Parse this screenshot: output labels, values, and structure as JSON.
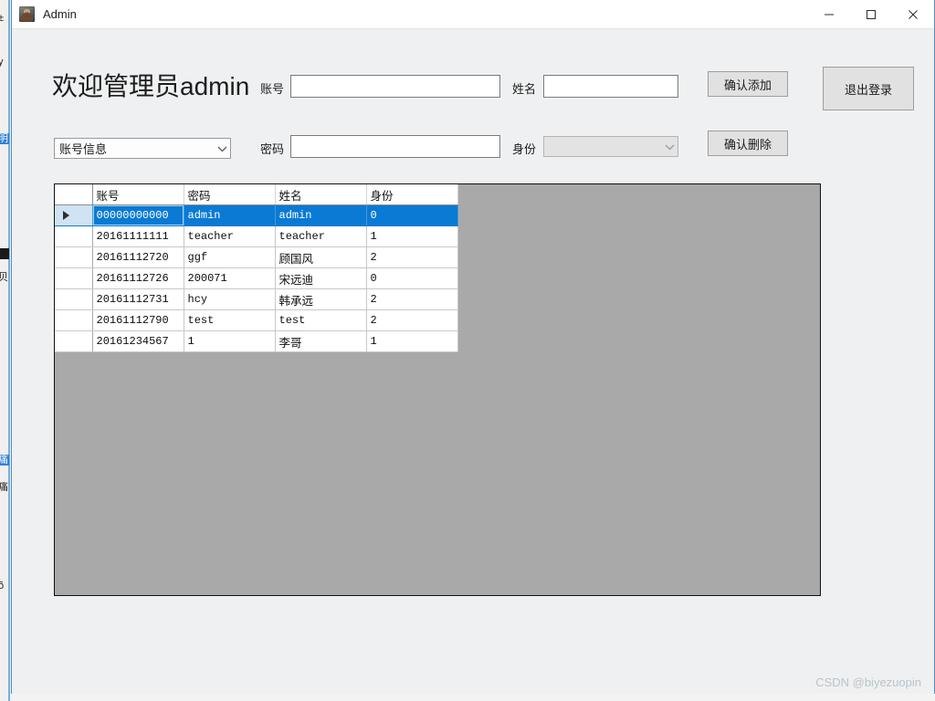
{
  "background_window": {
    "fragments": [
      "±",
      "y",
      "明",
      "贝",
      "痛",
      "痛",
      "õ"
    ]
  },
  "titlebar": {
    "title": "Admin",
    "icon": "user-photo-icon",
    "minimize_label": "minimize-icon",
    "maximize_label": "maximize-icon",
    "close_label": "close-icon"
  },
  "form": {
    "heading": "欢迎管理员admin",
    "fields": {
      "account_label": "账号",
      "account_value": "",
      "name_label": "姓名",
      "name_value": "",
      "password_label": "密码",
      "password_value": "",
      "identity_label": "身份",
      "identity_value": ""
    },
    "table_select": {
      "value": "账号信息"
    },
    "buttons": {
      "add": "确认添加",
      "delete": "确认删除",
      "logout": "退出登录"
    }
  },
  "grid": {
    "columns": [
      "账号",
      "密码",
      "姓名",
      "身份"
    ],
    "rows": [
      {
        "account": "00000000000",
        "password": "admin",
        "name": "admin",
        "identity": "0",
        "selected": true
      },
      {
        "account": "20161111111",
        "password": "teacher",
        "name": "teacher",
        "identity": "1",
        "selected": false
      },
      {
        "account": "20161112720",
        "password": "ggf",
        "name": "顾国风",
        "identity": "2",
        "selected": false
      },
      {
        "account": "20161112726",
        "password": "200071",
        "name": "宋远迪",
        "identity": "0",
        "selected": false
      },
      {
        "account": "20161112731",
        "password": "hcy",
        "name": "韩承远",
        "identity": "2",
        "selected": false
      },
      {
        "account": "20161112790",
        "password": "test",
        "name": "test",
        "identity": "2",
        "selected": false
      },
      {
        "account": "20161234567",
        "password": "1",
        "name": "李哥",
        "identity": "1",
        "selected": false
      }
    ]
  },
  "watermark": "CSDN @biyezuopin",
  "colors": {
    "selection_blue": "#0a7ad4",
    "grid_back": "#a9a9a9",
    "form_back": "#eff0f1",
    "window_border": "#4a90c4"
  }
}
